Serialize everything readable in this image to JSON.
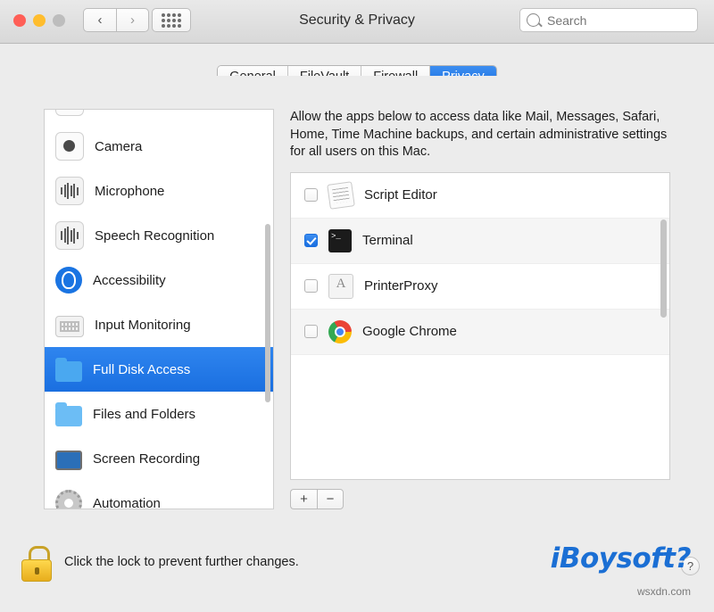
{
  "window": {
    "title": "Security & Privacy",
    "traffic_lights": [
      "close",
      "minimize",
      "zoom"
    ],
    "nav": {
      "back": "‹",
      "forward": "›",
      "grid": "all-preferences"
    },
    "search": {
      "placeholder": "Search",
      "value": ""
    }
  },
  "tabs": [
    {
      "label": "General",
      "active": false
    },
    {
      "label": "FileVault",
      "active": false
    },
    {
      "label": "Firewall",
      "active": false
    },
    {
      "label": "Privacy",
      "active": true
    }
  ],
  "services": [
    {
      "label": "Camera",
      "icon": "camera-icon",
      "selected": false
    },
    {
      "label": "Microphone",
      "icon": "microphone-icon",
      "selected": false
    },
    {
      "label": "Speech Recognition",
      "icon": "speech-recognition-icon",
      "selected": false
    },
    {
      "label": "Accessibility",
      "icon": "accessibility-icon",
      "selected": false
    },
    {
      "label": "Input Monitoring",
      "icon": "keyboard-icon",
      "selected": false
    },
    {
      "label": "Full Disk Access",
      "icon": "folder-icon",
      "selected": true
    },
    {
      "label": "Files and Folders",
      "icon": "folder-icon",
      "selected": false
    },
    {
      "label": "Screen Recording",
      "icon": "display-icon",
      "selected": false
    },
    {
      "label": "Automation",
      "icon": "gear-icon",
      "selected": false
    }
  ],
  "detail": {
    "description": "Allow the apps below to access data like Mail, Messages, Safari, Home, Time Machine backups, and certain administrative settings for all users on this Mac.",
    "apps": [
      {
        "name": "Script Editor",
        "icon": "script-editor-icon",
        "checked": false
      },
      {
        "name": "Terminal",
        "icon": "terminal-icon",
        "checked": true
      },
      {
        "name": "PrinterProxy",
        "icon": "printer-proxy-icon",
        "checked": false
      },
      {
        "name": "Google Chrome",
        "icon": "chrome-icon",
        "checked": false
      }
    ],
    "add_label": "+",
    "remove_label": "−"
  },
  "footer": {
    "lock_text": "Click the lock to prevent further changes.",
    "help_label": "?"
  },
  "watermark": {
    "brand_prefix": "i",
    "brand_rest": "Boysoft",
    "brand_suffix": "?",
    "site": "wsxdn.com"
  },
  "colors": {
    "accent": "#1a6fe0",
    "selected_row": "#2f85ef",
    "window_bg": "#ececec",
    "brand": "#1b6fd4"
  }
}
